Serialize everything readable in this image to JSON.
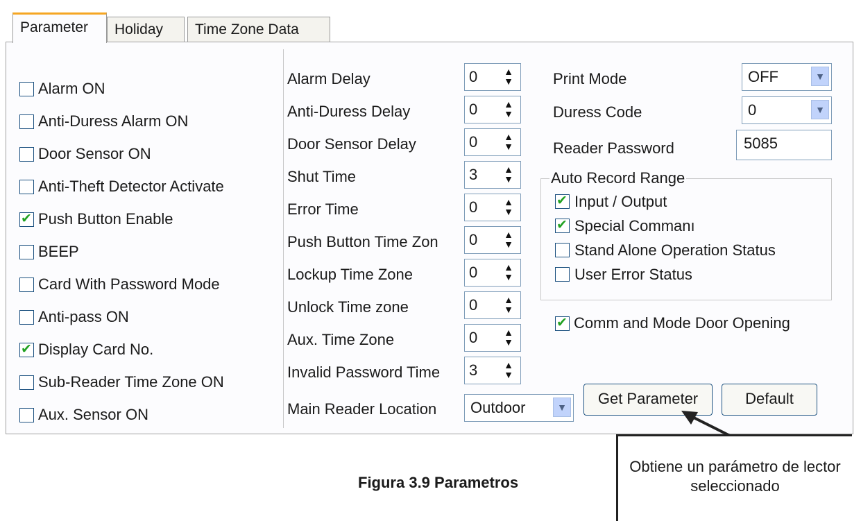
{
  "tabs": [
    "Parameter",
    "Holiday",
    "Time Zone Data"
  ],
  "checkboxes": [
    {
      "label": "Alarm ON",
      "checked": false
    },
    {
      "label": "Anti-Duress Alarm ON",
      "checked": false
    },
    {
      "label": "Door Sensor ON",
      "checked": false
    },
    {
      "label": "Anti-Theft Detector Activate",
      "checked": false
    },
    {
      "label": "Push Button Enable",
      "checked": true
    },
    {
      "label": "BEEP",
      "checked": false
    },
    {
      "label": "Card With Password Mode",
      "checked": false
    },
    {
      "label": "Anti-pass ON",
      "checked": false
    },
    {
      "label": "Display Card No.",
      "checked": true
    },
    {
      "label": "Sub-Reader Time Zone ON",
      "checked": false
    },
    {
      "label": "Aux. Sensor ON",
      "checked": false
    }
  ],
  "spinners": [
    {
      "label": "Alarm Delay",
      "value": "0"
    },
    {
      "label": "Anti-Duress Delay",
      "value": "0"
    },
    {
      "label": "Door Sensor Delay",
      "value": "0"
    },
    {
      "label": "Shut Time",
      "value": "3"
    },
    {
      "label": "Error Time",
      "value": "0"
    },
    {
      "label": "Push Button Time Zon",
      "value": "0"
    },
    {
      "label": "Lockup Time Zone",
      "value": "0"
    },
    {
      "label": "Unlock Time zone",
      "value": "0"
    },
    {
      "label": "Aux. Time Zone",
      "value": "0"
    },
    {
      "label": "Invalid Password Time",
      "value": "3"
    }
  ],
  "main_reader": {
    "label": "Main Reader Location",
    "value": "Outdoor"
  },
  "print_mode": {
    "label": "Print Mode",
    "value": "OFF"
  },
  "duress_code": {
    "label": "Duress Code",
    "value": "0"
  },
  "reader_password": {
    "label": "Reader Password",
    "value": "5085"
  },
  "auto_record": {
    "title": "Auto Record Range",
    "items": [
      {
        "label": "Input / Output",
        "checked": true
      },
      {
        "label": "Special Commanı",
        "checked": true
      },
      {
        "label": "Stand Alone Operation Status",
        "checked": false
      },
      {
        "label": "User Error Status",
        "checked": false
      }
    ]
  },
  "command_mode": {
    "label": "Comm and Mode Door Opening",
    "checked": true
  },
  "buttons": {
    "get_parameter": "Get Parameter",
    "default": "Default"
  },
  "caption": "Figura 3.9 Parametros",
  "callout": "Obtiene un parámetro de lector seleccionado"
}
